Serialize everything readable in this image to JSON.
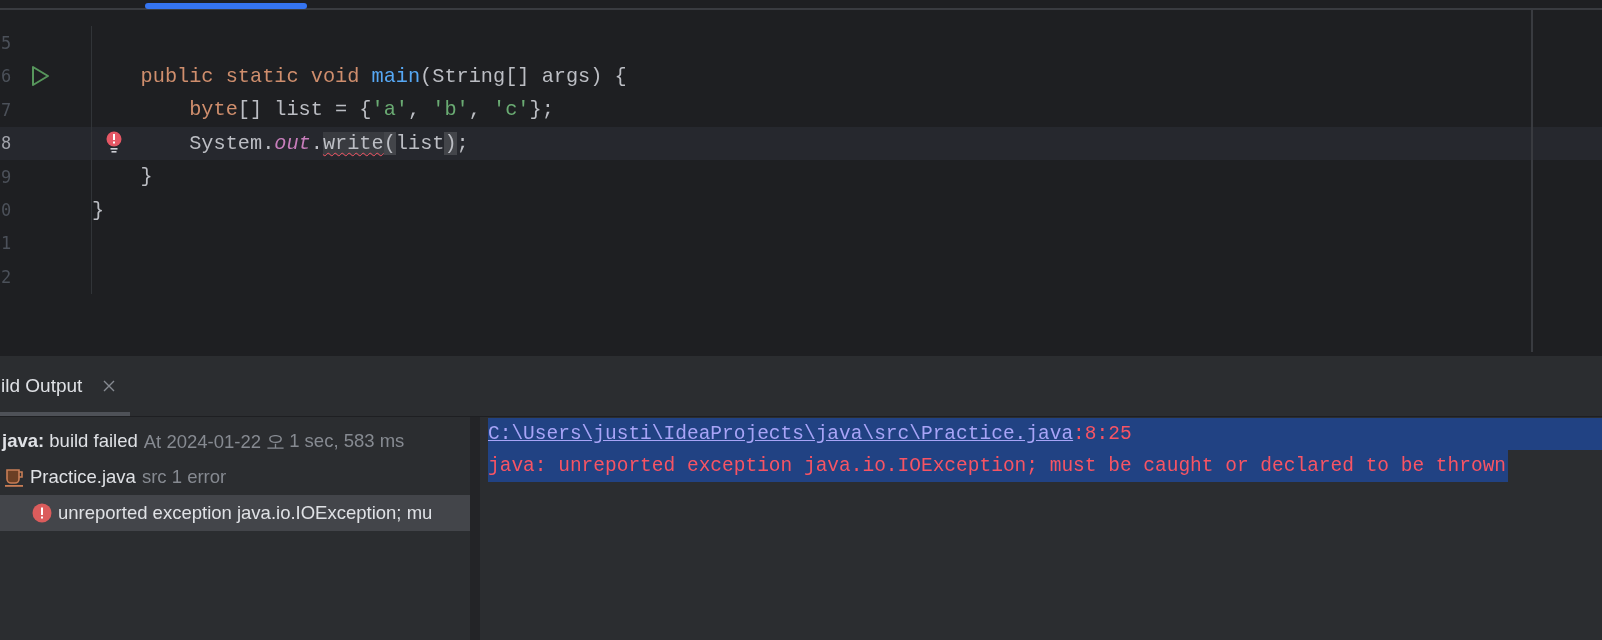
{
  "editor": {
    "lines": [
      {
        "number": "5",
        "current": false
      },
      {
        "number": "6",
        "marker": {
          "kind": "run"
        },
        "current": false,
        "tokens": [
          {
            "text": "    public static void ",
            "kind": "keyword"
          },
          {
            "text": "main",
            "kind": "method"
          },
          {
            "text": "(String[] args) {",
            "kind": "plain"
          }
        ]
      },
      {
        "number": "7",
        "current": false,
        "tokens": [
          {
            "text": "        byte",
            "kind": "keyword"
          },
          {
            "text": "[] list = {",
            "kind": "plain"
          },
          {
            "text": "'a'",
            "kind": "string"
          },
          {
            "text": ", ",
            "kind": "plain"
          },
          {
            "text": "'b'",
            "kind": "string"
          },
          {
            "text": ", ",
            "kind": "plain"
          },
          {
            "text": "'c'",
            "kind": "string"
          },
          {
            "text": "};",
            "kind": "plain"
          }
        ]
      },
      {
        "number": "8",
        "marker": {
          "kind": "error"
        },
        "current": true,
        "tokens": [
          {
            "text": "        System.",
            "kind": "plain"
          },
          {
            "text": "out",
            "kind": "field"
          },
          {
            "text": ".",
            "kind": "plain"
          },
          {
            "text": "write",
            "kind": "error"
          },
          {
            "text": "(",
            "kind": "match"
          },
          {
            "text": "list",
            "kind": "plain"
          },
          {
            "text": ")",
            "kind": "match"
          },
          {
            "text": ";",
            "kind": "plain"
          }
        ]
      },
      {
        "number": "9",
        "current": false,
        "tokens": [
          {
            "text": "    }",
            "kind": "plain"
          }
        ]
      },
      {
        "number": "0",
        "current": false,
        "tokens": [
          {
            "text": "}",
            "kind": "plain"
          }
        ]
      },
      {
        "number": "1",
        "current": false
      },
      {
        "number": "2",
        "current": false
      }
    ]
  },
  "build_panel": {
    "tab": {
      "label": "ild Output",
      "selected": true
    },
    "tree": [
      {
        "kind": "build",
        "label": "**java:** build failed",
        "detail": "At 2024-01-22 오",
        "duration": "1 sec, 583 ms",
        "selected": false,
        "children": [
          {
            "kind": "file",
            "label": "Practice.java",
            "detail": "src 1 error",
            "selected": false,
            "children": [
              {
                "kind": "error",
                "label": "unreported exception java.io.IOException; mu",
                "selected": true
              }
            ]
          }
        ]
      }
    ],
    "console": [
      {
        "kind": "location",
        "link": "C:\\Users\\justi\\IdeaProjects\\java\\src\\Practice.java",
        "suffix": ":8:25",
        "selected": true
      },
      {
        "kind": "message",
        "text": "java: unreported exception java.io.IOException; must be caught or declared to be thrown",
        "selected": true
      }
    ]
  }
}
